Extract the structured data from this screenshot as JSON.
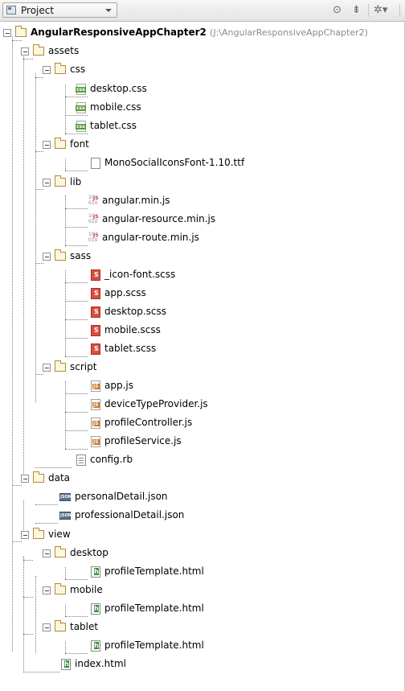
{
  "toolbar": {
    "view_label": "Project",
    "icons": [
      "target-icon",
      "collapse-all-icon",
      "settings-icon"
    ],
    "icon_glyphs": [
      "⊙",
      "⇟",
      "✲▾"
    ]
  },
  "tree": {
    "root": {
      "name": "AngularResponsiveAppChapter2",
      "path": "(J:\\AngularResponsiveAppChapter2)"
    },
    "folders": {
      "assets": "assets",
      "css": "css",
      "font": "font",
      "lib": "lib",
      "sass": "sass",
      "script": "script",
      "data": "data",
      "view": "view",
      "desktop": "desktop",
      "mobile": "mobile",
      "tablet": "tablet"
    },
    "files": {
      "css": [
        "desktop.css",
        "mobile.css",
        "tablet.css"
      ],
      "font": [
        "MonoSocialIconsFont-1.10.ttf"
      ],
      "lib": [
        "angular.min.js",
        "angular-resource.min.js",
        "angular-route.min.js"
      ],
      "sass": [
        "_icon-font.scss",
        "app.scss",
        "desktop.scss",
        "mobile.scss",
        "tablet.scss"
      ],
      "script": [
        "app.js",
        "deviceTypeProvider.js",
        "profileController.js",
        "profileService.js"
      ],
      "assets_root": [
        "config.rb"
      ],
      "data": [
        "personalDetail.json",
        "professionalDetail.json"
      ],
      "view_desktop": [
        "profileTemplate.html"
      ],
      "view_mobile": [
        "profileTemplate.html"
      ],
      "view_tablet": [
        "profileTemplate.html"
      ],
      "root": [
        "index.html"
      ]
    }
  }
}
